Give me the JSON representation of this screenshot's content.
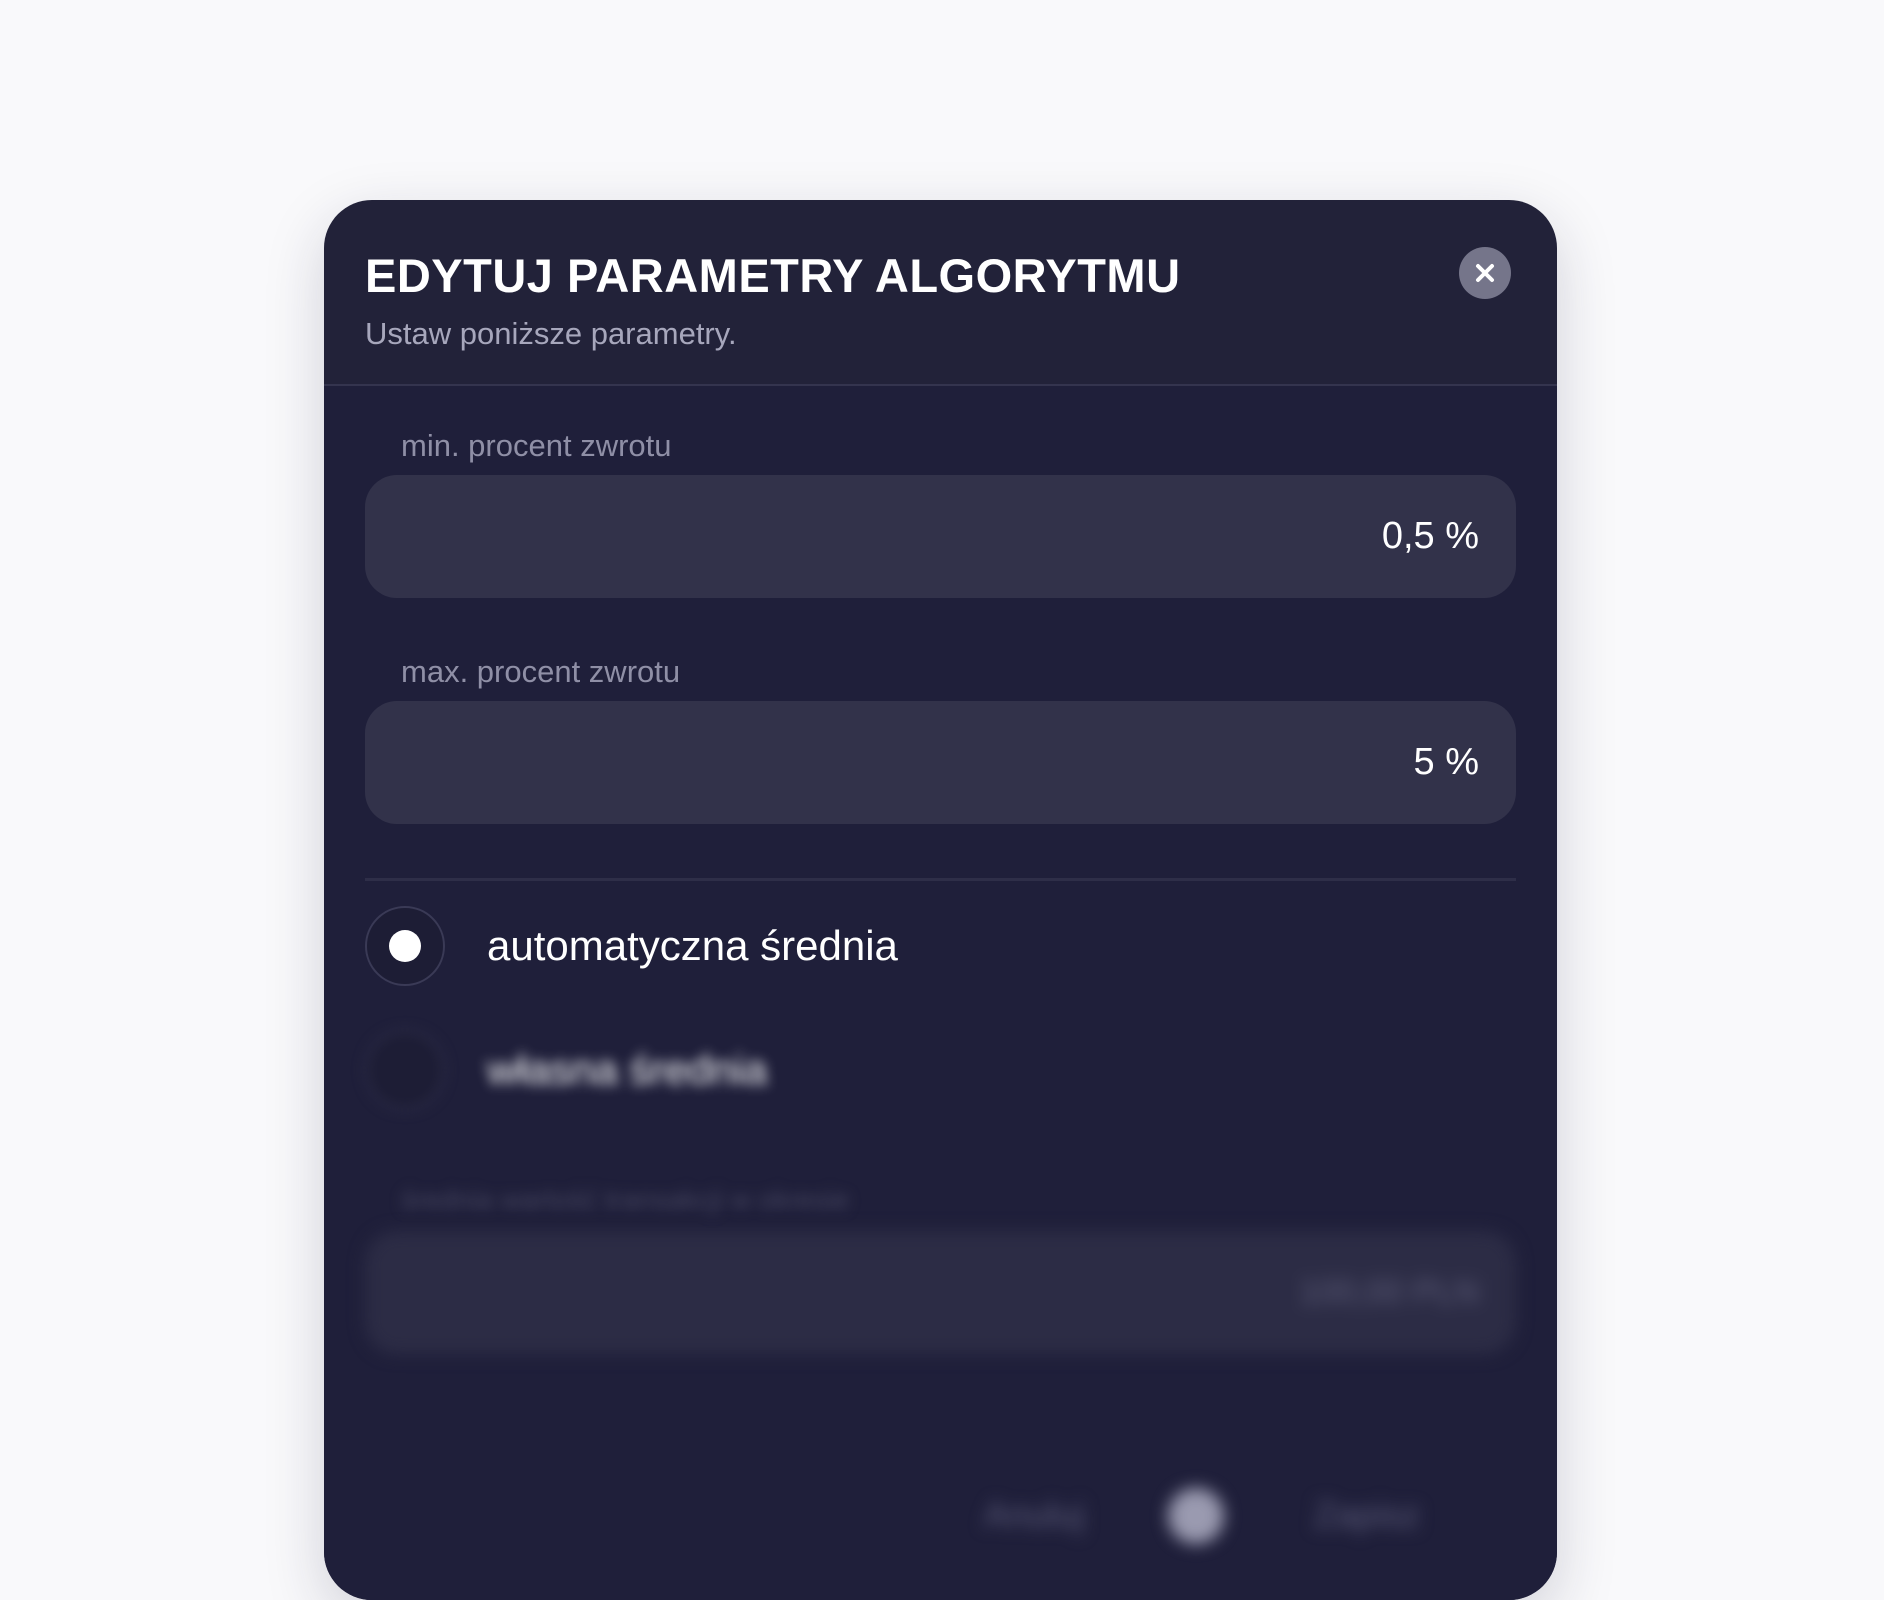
{
  "modal": {
    "title": "EDYTUJ PARAMETRY ALGORYTMU",
    "subtitle": "Ustaw poniższe parametry."
  },
  "fields": {
    "min_return": {
      "label": "min. procent zwrotu",
      "value": "0,5 %"
    },
    "max_return": {
      "label": "max. procent zwrotu",
      "value": "5 %"
    },
    "average_value": {
      "label": "średnia wartość transakcji w okresie",
      "value": "100,00 PLN"
    }
  },
  "average_mode": {
    "selected": "automatyczna średnia",
    "options": [
      {
        "label": "automatyczna średnia",
        "selected": true
      },
      {
        "label": "własna średnia",
        "selected": false
      }
    ]
  },
  "footer": {
    "cancel_label": "Anuluj",
    "save_label": "Zapisz"
  },
  "icons": {
    "close": "close-icon"
  },
  "colors": {
    "modal_header": "#222239",
    "modal_body": "#1f1f3a",
    "input_background": "#32324a",
    "page_background": "#f9f9fb",
    "close_button": "#75758a"
  }
}
